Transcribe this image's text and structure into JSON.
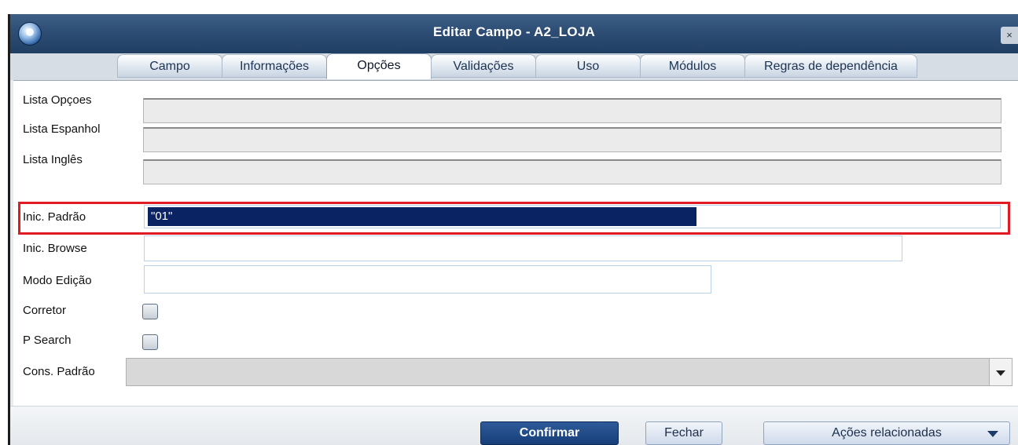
{
  "window": {
    "title": "Editar Campo - A2_LOJA",
    "close_label": "×"
  },
  "tabs": [
    {
      "label": "Campo",
      "active": false
    },
    {
      "label": "Informações",
      "active": false
    },
    {
      "label": "Opções",
      "active": true
    },
    {
      "label": "Validações",
      "active": false
    },
    {
      "label": "Uso",
      "active": false
    },
    {
      "label": "Módulos",
      "active": false
    },
    {
      "label": "Regras de dependência",
      "active": false
    }
  ],
  "fields": {
    "lista_opcoes": {
      "label": "Lista Opçoes",
      "value": ""
    },
    "lista_espanhol": {
      "label": "Lista Espanhol",
      "value": ""
    },
    "lista_ingles": {
      "label": "Lista Inglês",
      "value": ""
    },
    "inic_padrao": {
      "label": "Inic. Padrão",
      "value": "\"01\""
    },
    "inic_browse": {
      "label": "Inic. Browse",
      "value": ""
    },
    "modo_edicao": {
      "label": "Modo Edição",
      "value": ""
    },
    "corretor": {
      "label": "Corretor",
      "checked": false
    },
    "p_search": {
      "label": "P Search",
      "checked": false
    },
    "cons_padrao": {
      "label": "Cons. Padrão",
      "value": ""
    }
  },
  "buttons": {
    "confirmar": "Confirmar",
    "fechar": "Fechar",
    "acoes": "Ações relacionadas"
  },
  "colors": {
    "titlebar": "#2d4d74",
    "selection": "#0a2363",
    "highlight_border": "#e01b24",
    "primary_button": "#163e78"
  }
}
